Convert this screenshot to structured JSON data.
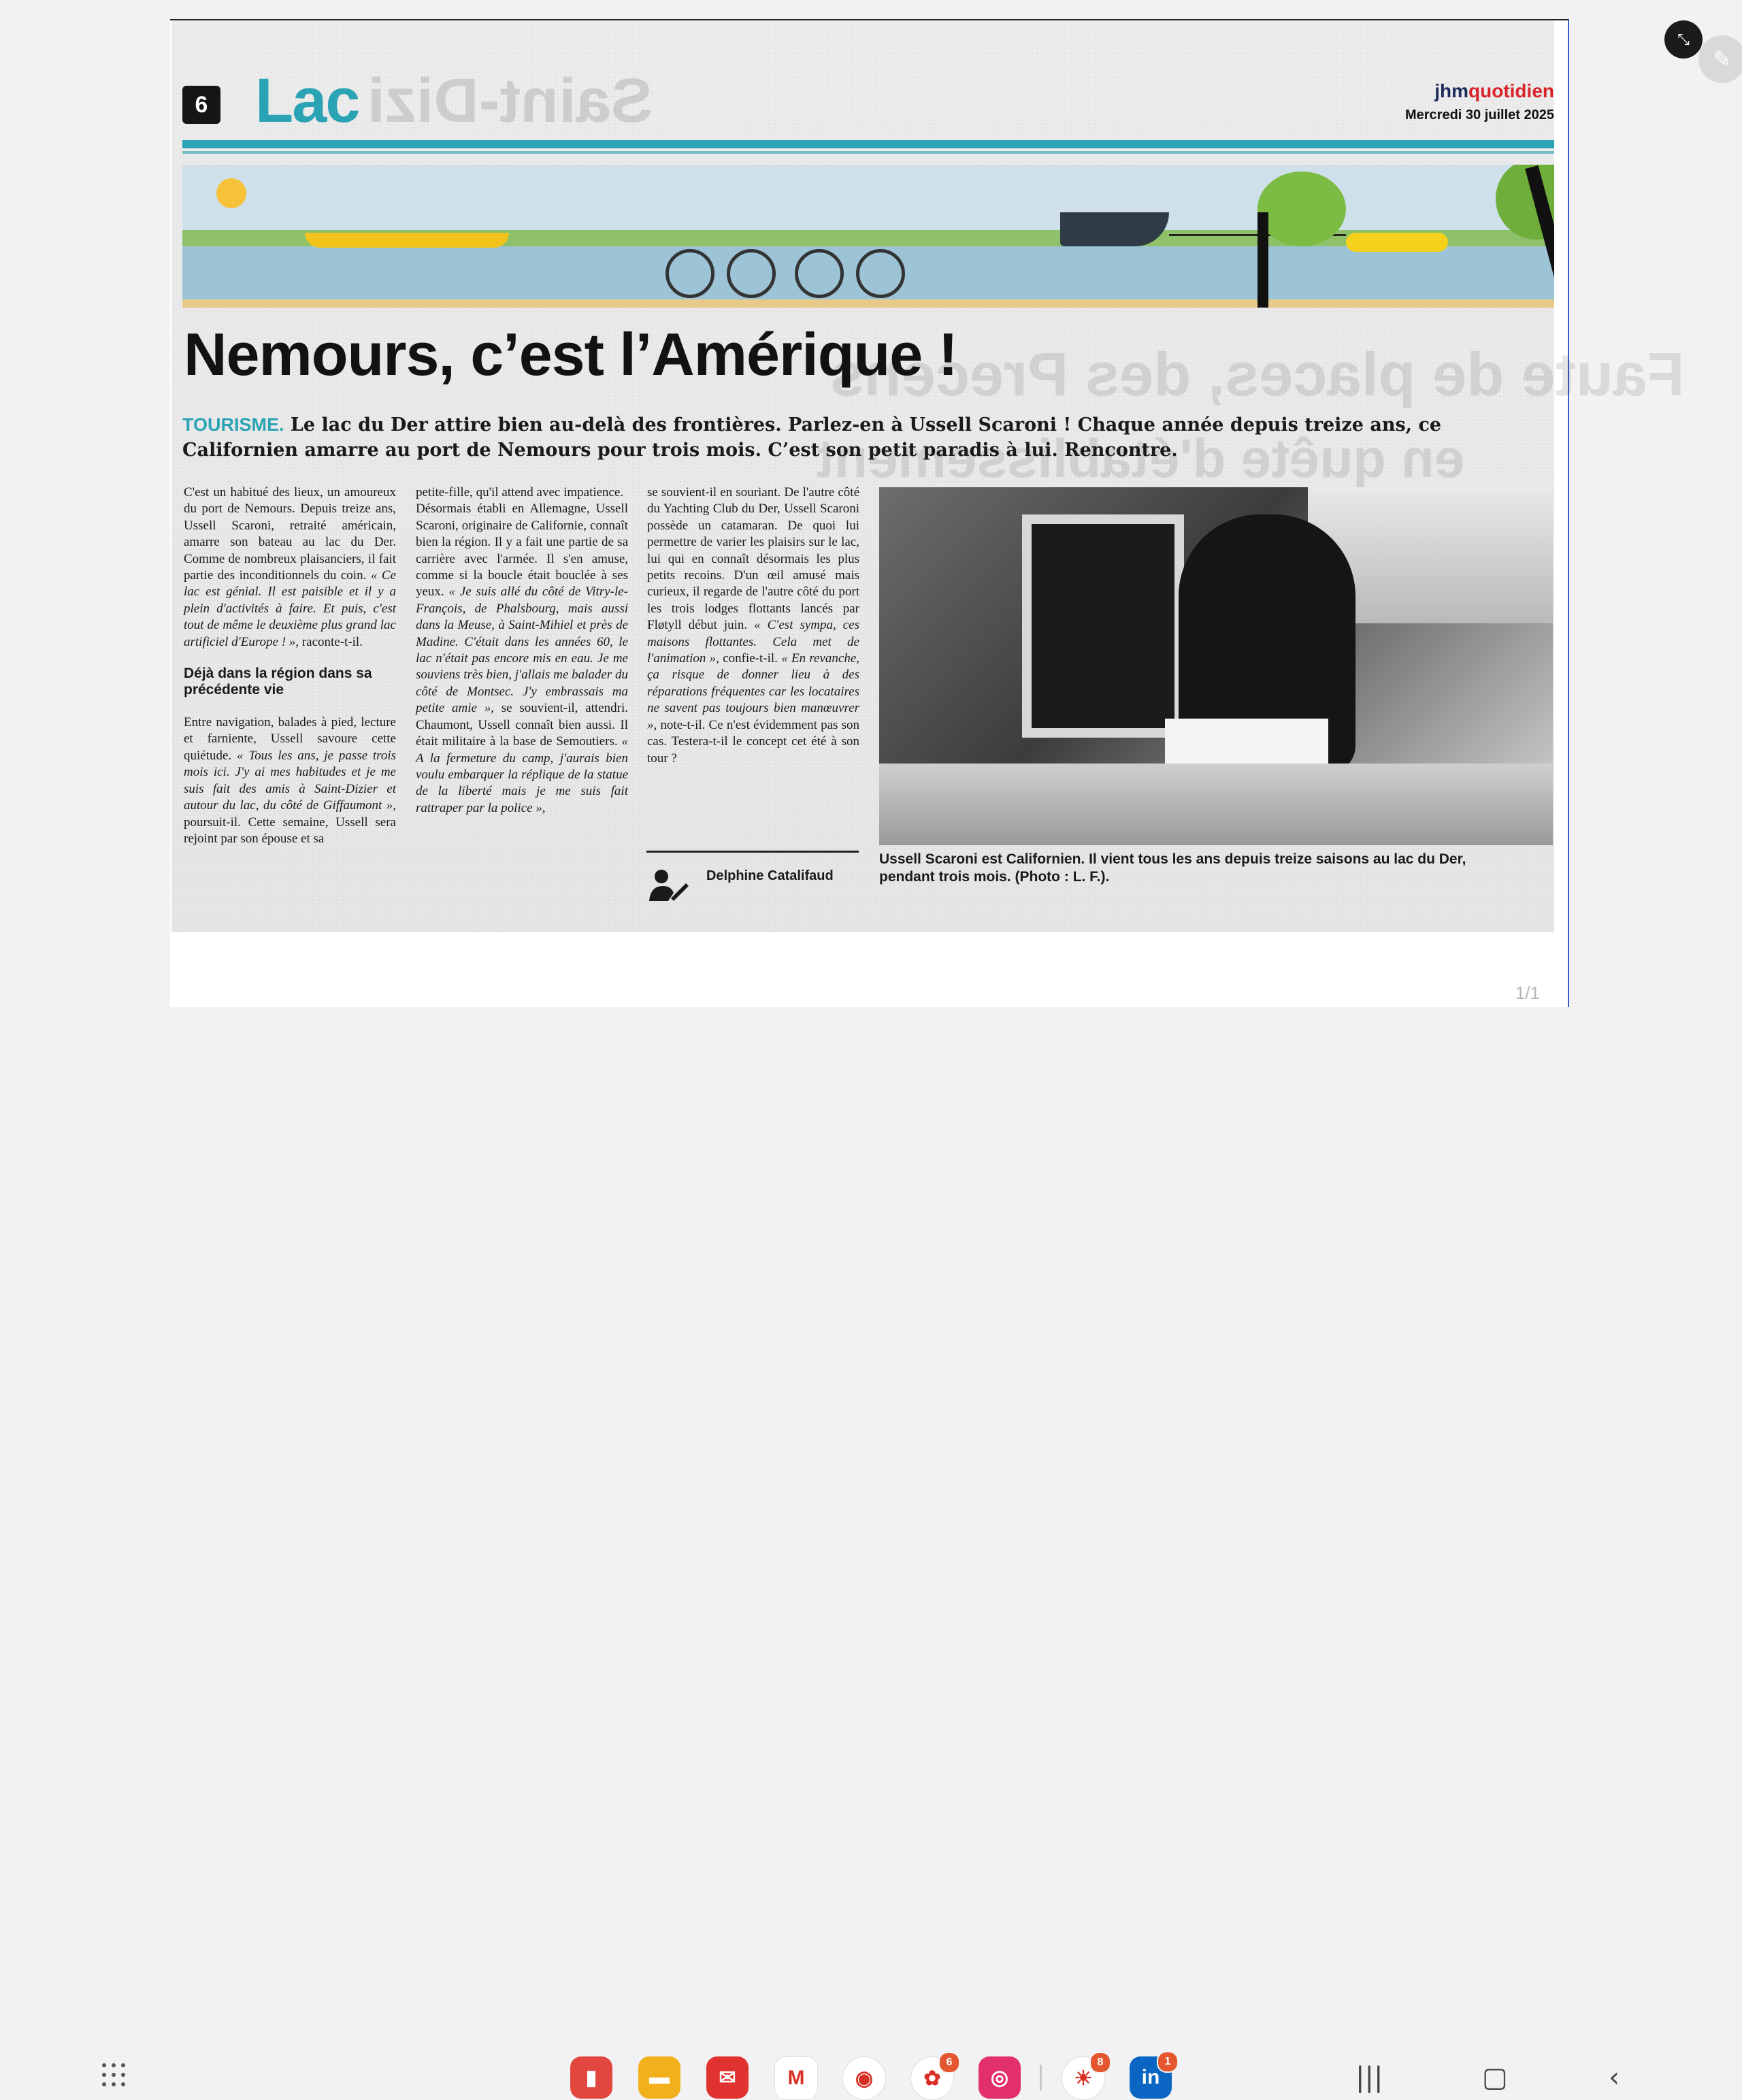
{
  "article": {
    "page_number": "6",
    "section": "Lac",
    "ghost_text_1": "Saint-Dizi",
    "brand_part1": "jhm",
    "brand_part2": "quotidien",
    "date": "Mercredi 30 juillet 2025",
    "headline": "Nemours, c’est l’Amérique !",
    "ghost_headline_1": "Faute de places, des Precens",
    "ghost_headline_2": "en quête d'établissement",
    "kicker": "TOURISME.",
    "chapo": "Le lac du Der attire bien au-delà des frontières. Parlez-en à Ussell Scaroni ! Chaque année depuis treize ans, ce Californien amarre au port de Nemours pour trois mois. C’est son petit paradis à lui. Rencontre.",
    "col1_p1": "C'est un habitué des lieux, un amoureux du port de Nemours. Depuis treize ans, Ussell Scaroni, retraité américain, amarre son bateau au lac du Der. Comme de nombreux plaisanciers, il fait partie des inconditionnels du coin.",
    "col1_q1": "« Ce lac est génial. Il est paisible et il y a plein d'activités à faire. Et puis, c'est tout de même le deuxième plus grand lac artificiel d'Europe ! »,",
    "col1_p1_end": "raconte-t-il.",
    "subhead": "Déjà dans la région dans sa précédente vie",
    "col1_p2": "Entre navigation, balades à pied, lecture et farniente, Ussell savoure cette quiétude.",
    "col1_q2": "« Tous les ans, je passe trois mois ici. J'y ai mes habitudes et je me suis fait des amis à Saint-Dizier et autour du lac, du côté de Giffaumont »,",
    "col1_p2_end": "poursuit-il. Cette semaine, Ussell sera rejoint par son épouse et sa",
    "col2_p1": "petite-fille, qu'il attend avec impatience.",
    "col2_p2": "Désormais établi en Allemagne, Ussell Scaroni, originaire de Californie, connaît bien la région. Il y a fait une partie de sa carrière avec l'armée. Il s'en amuse, comme si la boucle était bouclée à ses yeux.",
    "col2_q1": "« Je suis allé du côté de Vitry-le-François, de Phalsbourg, mais aussi dans la Meuse, à Saint-Mihiel et près de Madine. C'était dans les années 60, le lac n'était pas encore mis en eau. Je me souviens très bien, j'allais me balader du côté de Montsec. J'y embrassais ma petite amie »,",
    "col2_p3": "se souvient-il, attendri. Chaumont, Ussell connaît bien aussi. Il était militaire à la base de Semoutiers.",
    "col2_q2": "« A la fermeture du camp, j'aurais bien voulu embarquer la réplique de la statue de la liberté mais je me suis fait rattraper par la police »,",
    "col3_p1": "se souvient-il en souriant. De l'autre côté du Yachting Club du Der, Ussell Scaroni possède un catamaran. De quoi lui permettre de varier les plaisirs sur le lac, lui qui en connaît désormais les plus petits recoins. D'un œil amusé mais curieux, il regarde de l'autre côté du port les trois lodges flottants lancés par Fløtyll début juin.",
    "col3_q1": "« C'est sympa, ces maisons flottantes. Cela met de l'animation »,",
    "col3_p2": "confie-t-il.",
    "col3_q2": "« En revanche, ça risque de donner lieu à des réparations fréquentes car les locataires ne savent pas toujours bien manœuvrer »,",
    "col3_p3": "note-t-il. Ce n'est évidemment pas son cas. Testera-t-il le concept cet été à son tour ?",
    "author": "Delphine Catalifaud",
    "caption": "Ussell Scaroni est Californien. Il vient tous les ans depuis treize saisons au lac du Der, pendant trois mois. (Photo : L. F.)."
  },
  "viewer": {
    "page_indicator": "1/1",
    "exit_fullscreen_icon": "collapse-icon",
    "edit_icon": "pencil-icon"
  },
  "taskbar": {
    "apps": [
      {
        "name": "notes-app",
        "color": "#e2473f",
        "glyph": "▮"
      },
      {
        "name": "files-app",
        "color": "#f3b01d",
        "glyph": "▬"
      },
      {
        "name": "mail-app",
        "color": "#e0322e",
        "glyph": "✉"
      },
      {
        "name": "gmail-app",
        "color": "#ffffff",
        "glyph": "M"
      },
      {
        "name": "chrome-app",
        "color": "#ffffff",
        "glyph": "◉"
      },
      {
        "name": "photos-app",
        "color": "#ffffff",
        "glyph": "✿",
        "badge": "6"
      },
      {
        "name": "instagram-app",
        "color": "#e1306c",
        "glyph": "◎"
      },
      {
        "name": "weather-app",
        "color": "#ffffff",
        "glyph": "☀",
        "badge": "8"
      },
      {
        "name": "linkedin-app",
        "color": "#0a66c2",
        "glyph": "in",
        "badge": "1"
      }
    ]
  }
}
